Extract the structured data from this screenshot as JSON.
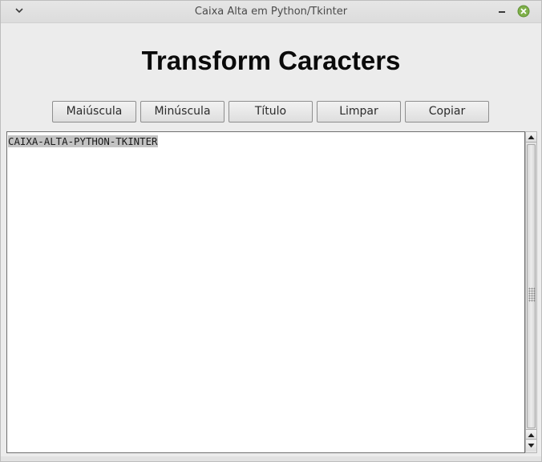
{
  "window": {
    "title": "Caixa Alta em Python/Tkinter"
  },
  "heading": "Transform Caracters",
  "buttons": {
    "uppercase": "Maiúscula",
    "lowercase": "Minúscula",
    "title": "Título",
    "clear": "Limpar",
    "copy": "Copiar"
  },
  "text_area": {
    "content": "CAIXA-ALTA-PYTHON-TKINTER"
  },
  "icons": {
    "menu": "chevron-down-icon",
    "minimize": "minimize-icon",
    "close": "close-icon",
    "scroll_up": "arrow-up-icon",
    "scroll_down": "arrow-down-icon"
  },
  "colors": {
    "close_button": "#7fb04a",
    "selection": "#c3c3c3"
  }
}
